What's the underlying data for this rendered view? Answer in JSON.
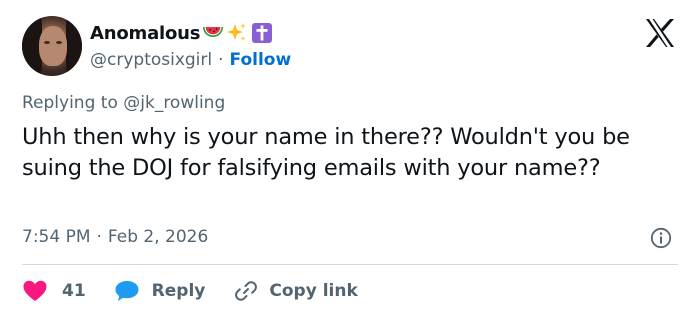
{
  "user": {
    "display_name": "Anomalous",
    "emojis": [
      "watermelon-emoji",
      "sparkles-emoji",
      "latin-cross-emoji"
    ],
    "handle": "@cryptosixgirl",
    "separator": "·",
    "follow_label": "Follow"
  },
  "tweet": {
    "replying_to": "Replying to @jk_rowling",
    "text": "Uhh then why is your name in there?? Wouldn't you be suing the DOJ for falsifying emails with your name??",
    "time": "7:54 PM",
    "date_separator": "·",
    "date": "Feb 2, 2026"
  },
  "actions": {
    "like_count": "41",
    "reply_label": "Reply",
    "copy_link_label": "Copy link"
  },
  "colors": {
    "text": "#0f1419",
    "muted": "#536471",
    "link": "#006fd6",
    "heart": "#f91880",
    "reply_bubble": "#1d9bf0",
    "divider": "#cfd9de"
  },
  "icons": {
    "brand": "x-logo-icon",
    "info": "info-icon",
    "like": "heart-icon",
    "reply": "speech-bubble-icon",
    "copy": "link-icon"
  }
}
